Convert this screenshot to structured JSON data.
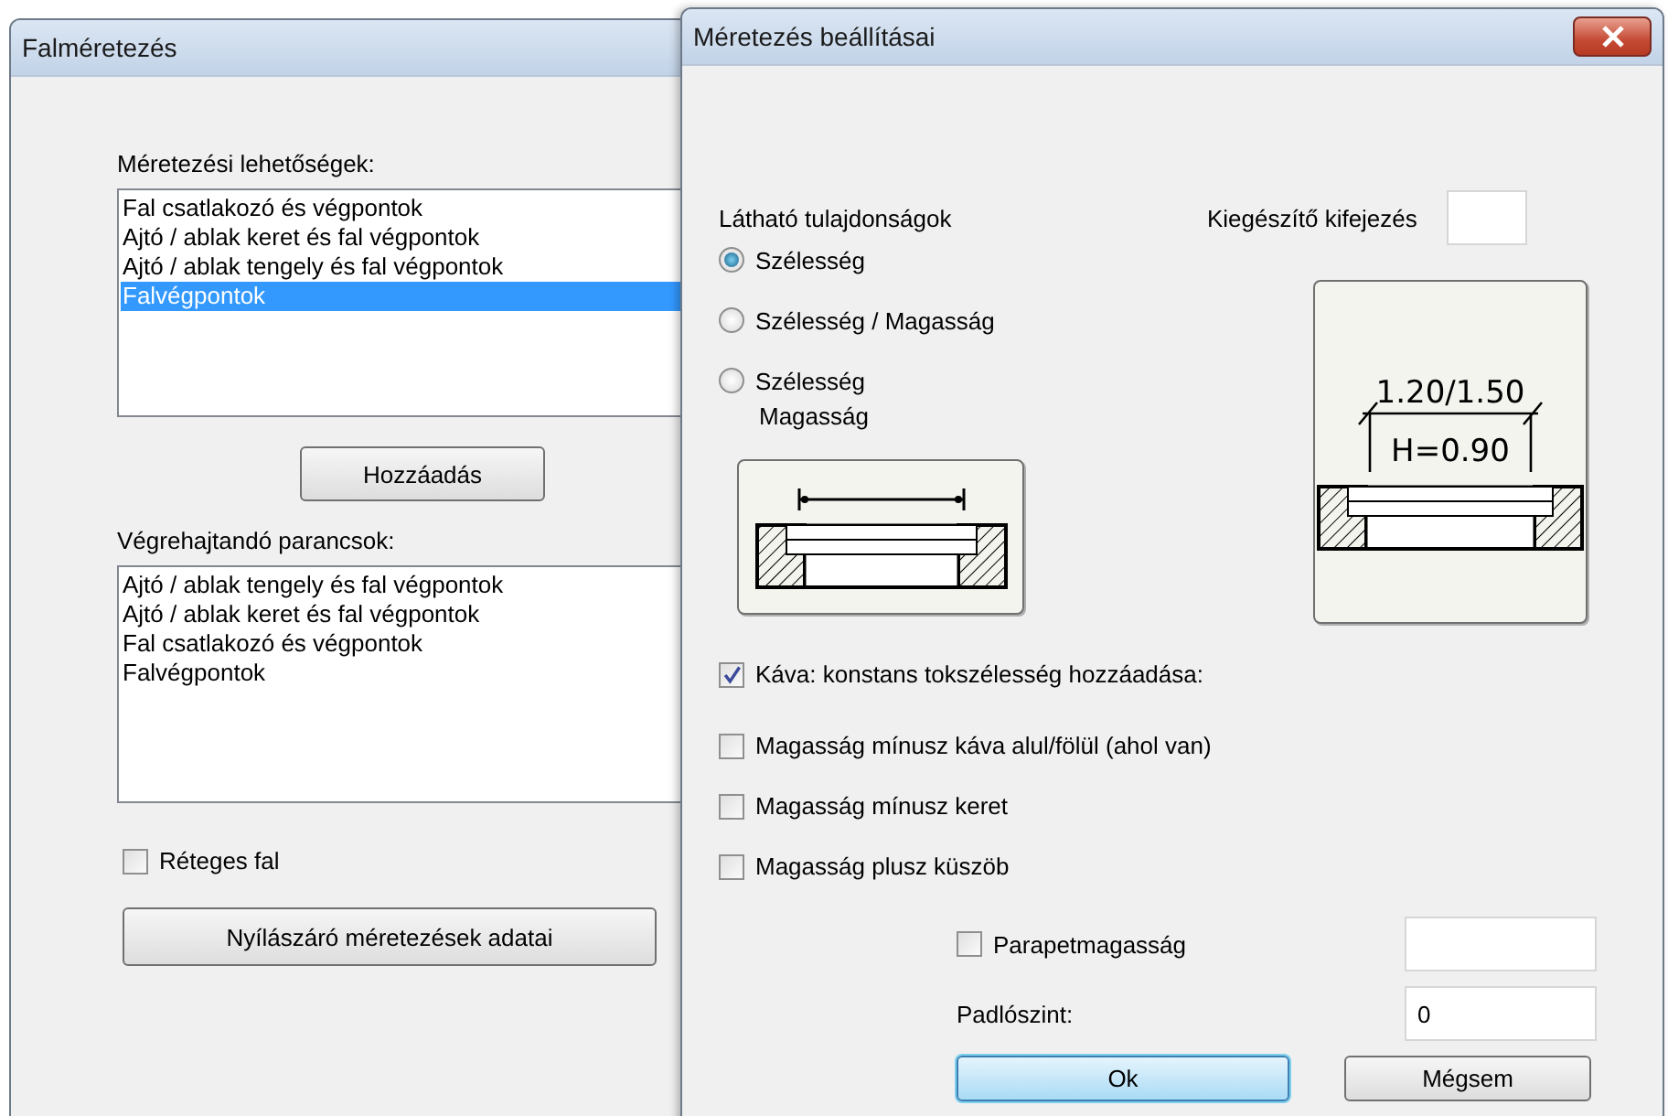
{
  "back_window": {
    "title": "Falméretezés",
    "options_label": "Méretezési lehetőségek:",
    "options": [
      {
        "label": "Fal csatlakozó és végpontok",
        "selected": false
      },
      {
        "label": "Ajtó / ablak keret és fal végpontok",
        "selected": false
      },
      {
        "label": "Ajtó / ablak tengely és fal végpontok",
        "selected": false
      },
      {
        "label": "Falvégpontok",
        "selected": true
      }
    ],
    "add_button": "Hozzáadás",
    "commands_label": "Végrehajtandó parancsok:",
    "commands": [
      "Ajtó / ablak tengely és fal végpontok",
      "Ajtó / ablak keret és fal végpontok",
      "Fal csatlakozó és végpontok",
      "Falvégpontok"
    ],
    "layered_wall": {
      "label": "Réteges fal",
      "checked": false
    },
    "openings_button": "Nyílászáró méretezések adatai"
  },
  "front_window": {
    "title": "Méretezés beállításai",
    "visible_label": "Látható tulajdonságok",
    "radios": [
      {
        "lines": [
          "Szélesség"
        ],
        "selected": true
      },
      {
        "lines": [
          "Szélesség / Magasság"
        ],
        "selected": false
      },
      {
        "lines": [
          "Szélesség",
          "Magasság"
        ],
        "selected": false
      }
    ],
    "extra_label": "Kiegészítő kifejezés",
    "preview_labels": [
      "1.20/1.50",
      "H=0.90"
    ],
    "checks": [
      {
        "label": "Káva: konstans tokszélesség hozzáadása:",
        "checked": true
      },
      {
        "label": "Magasság mínusz káva alul/fölül (ahol van)",
        "checked": false
      },
      {
        "label": "Magasság mínusz keret",
        "checked": false
      },
      {
        "label": "Magasság plusz küszöb",
        "checked": false
      }
    ],
    "parapet": {
      "label": "Parapetmagasság",
      "checked": false
    },
    "floor_label": "Padlószint:",
    "floor_value": "0",
    "ok_button": "Ok",
    "cancel_button": "Mégsem"
  }
}
